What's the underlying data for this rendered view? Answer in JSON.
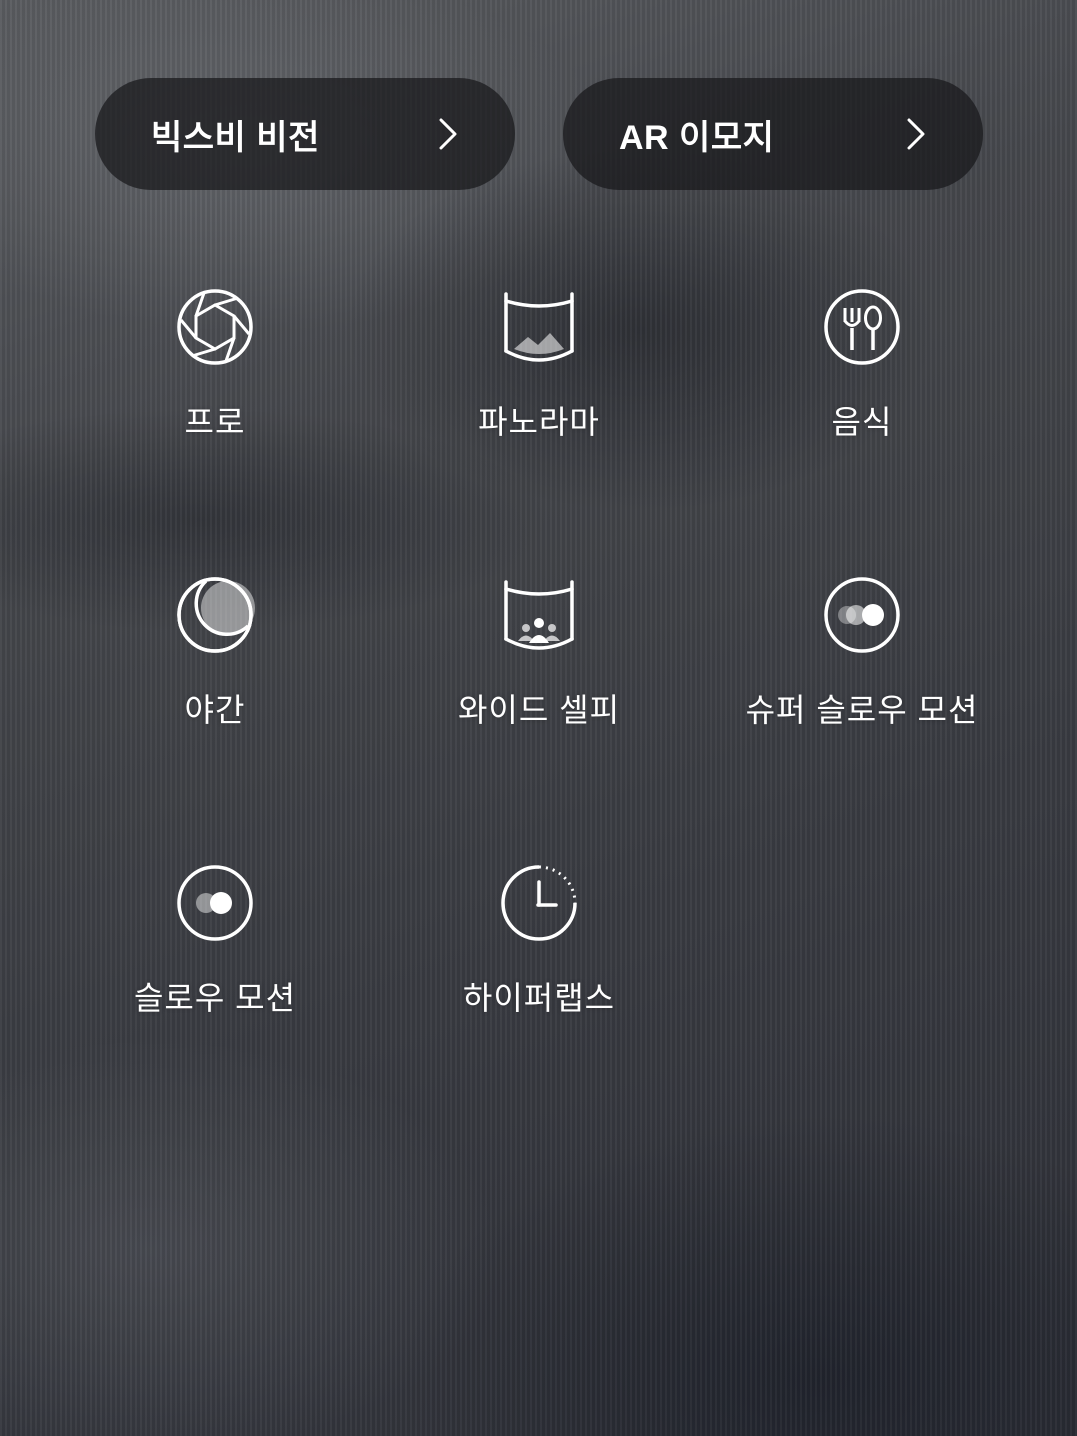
{
  "quick_actions": [
    {
      "label": "빅스비 비전",
      "icon": "chevron-right-icon"
    },
    {
      "label": "AR 이모지",
      "icon": "chevron-right-icon"
    }
  ],
  "modes": [
    {
      "label": "프로",
      "icon": "aperture-icon"
    },
    {
      "label": "파노라마",
      "icon": "panorama-icon"
    },
    {
      "label": "음식",
      "icon": "fork-spoon-icon"
    },
    {
      "label": "야간",
      "icon": "moon-icon"
    },
    {
      "label": "와이드 셀피",
      "icon": "wide-selfie-icon"
    },
    {
      "label": "슈퍼 슬로우 모션",
      "icon": "super-slow-motion-icon"
    },
    {
      "label": "슬로우 모션",
      "icon": "slow-motion-icon"
    },
    {
      "label": "하이퍼랩스",
      "icon": "hyperlapse-clock-icon"
    }
  ]
}
